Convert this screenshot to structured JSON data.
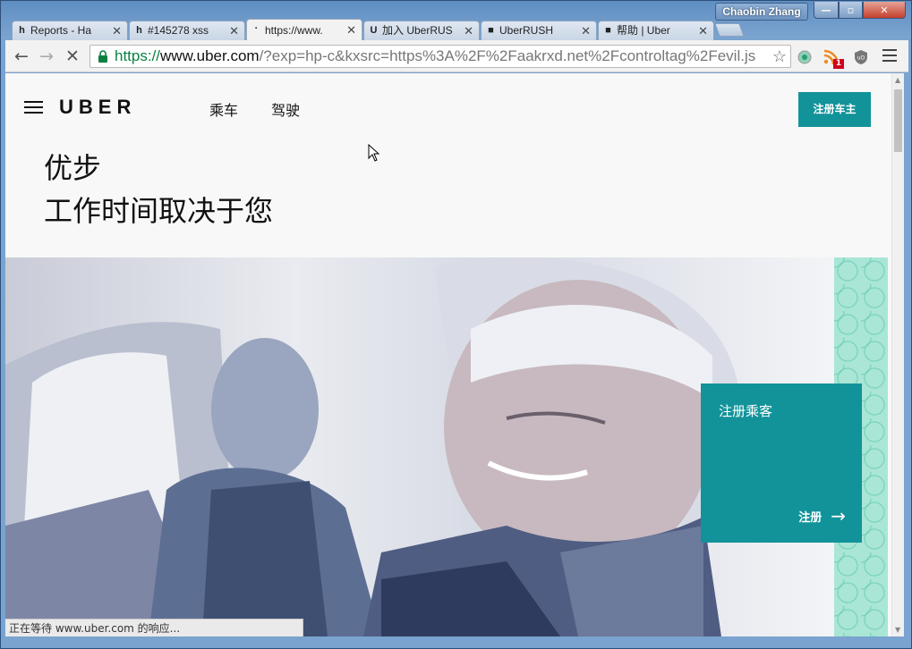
{
  "window": {
    "user_name": "Chaobin Zhang",
    "controls": {
      "minimize": "—",
      "maximize": "▫",
      "close": "✕"
    }
  },
  "tabs": [
    {
      "label": "Reports - Ha",
      "favicon": "h",
      "active": false
    },
    {
      "label": "#145278 xss",
      "favicon": "h",
      "active": false
    },
    {
      "label": "https://www.",
      "favicon": "·",
      "active": true
    },
    {
      "label": "加入 UberRUS",
      "favicon": "U",
      "active": false
    },
    {
      "label": "UberRUSH",
      "favicon": "■",
      "active": false
    },
    {
      "label": "帮助 | Uber",
      "favicon": "■",
      "active": false
    }
  ],
  "toolbar": {
    "url_scheme": "https://",
    "url_host": "www.uber.com",
    "url_rest": "/?exp=hp-c&kxsrc=https%3A%2F%2Faakrxd.net%2Fcontroltag%2Fevil.js",
    "rss_badge": "1"
  },
  "page": {
    "logo": "UBER",
    "nav": [
      "乘车",
      "驾驶"
    ],
    "signup_driver": "注册车主",
    "headline_line1": "优步",
    "headline_line2": "工作时间取决于您",
    "card_title": "注册乘客",
    "card_action": "注册",
    "card_arrow": "→"
  },
  "status": {
    "text": "正在等待 www.uber.com 的响应..."
  },
  "colors": {
    "brand_teal": "#12939a",
    "pattern_mint": "#a9e6d6",
    "url_green": "#0b8043"
  }
}
